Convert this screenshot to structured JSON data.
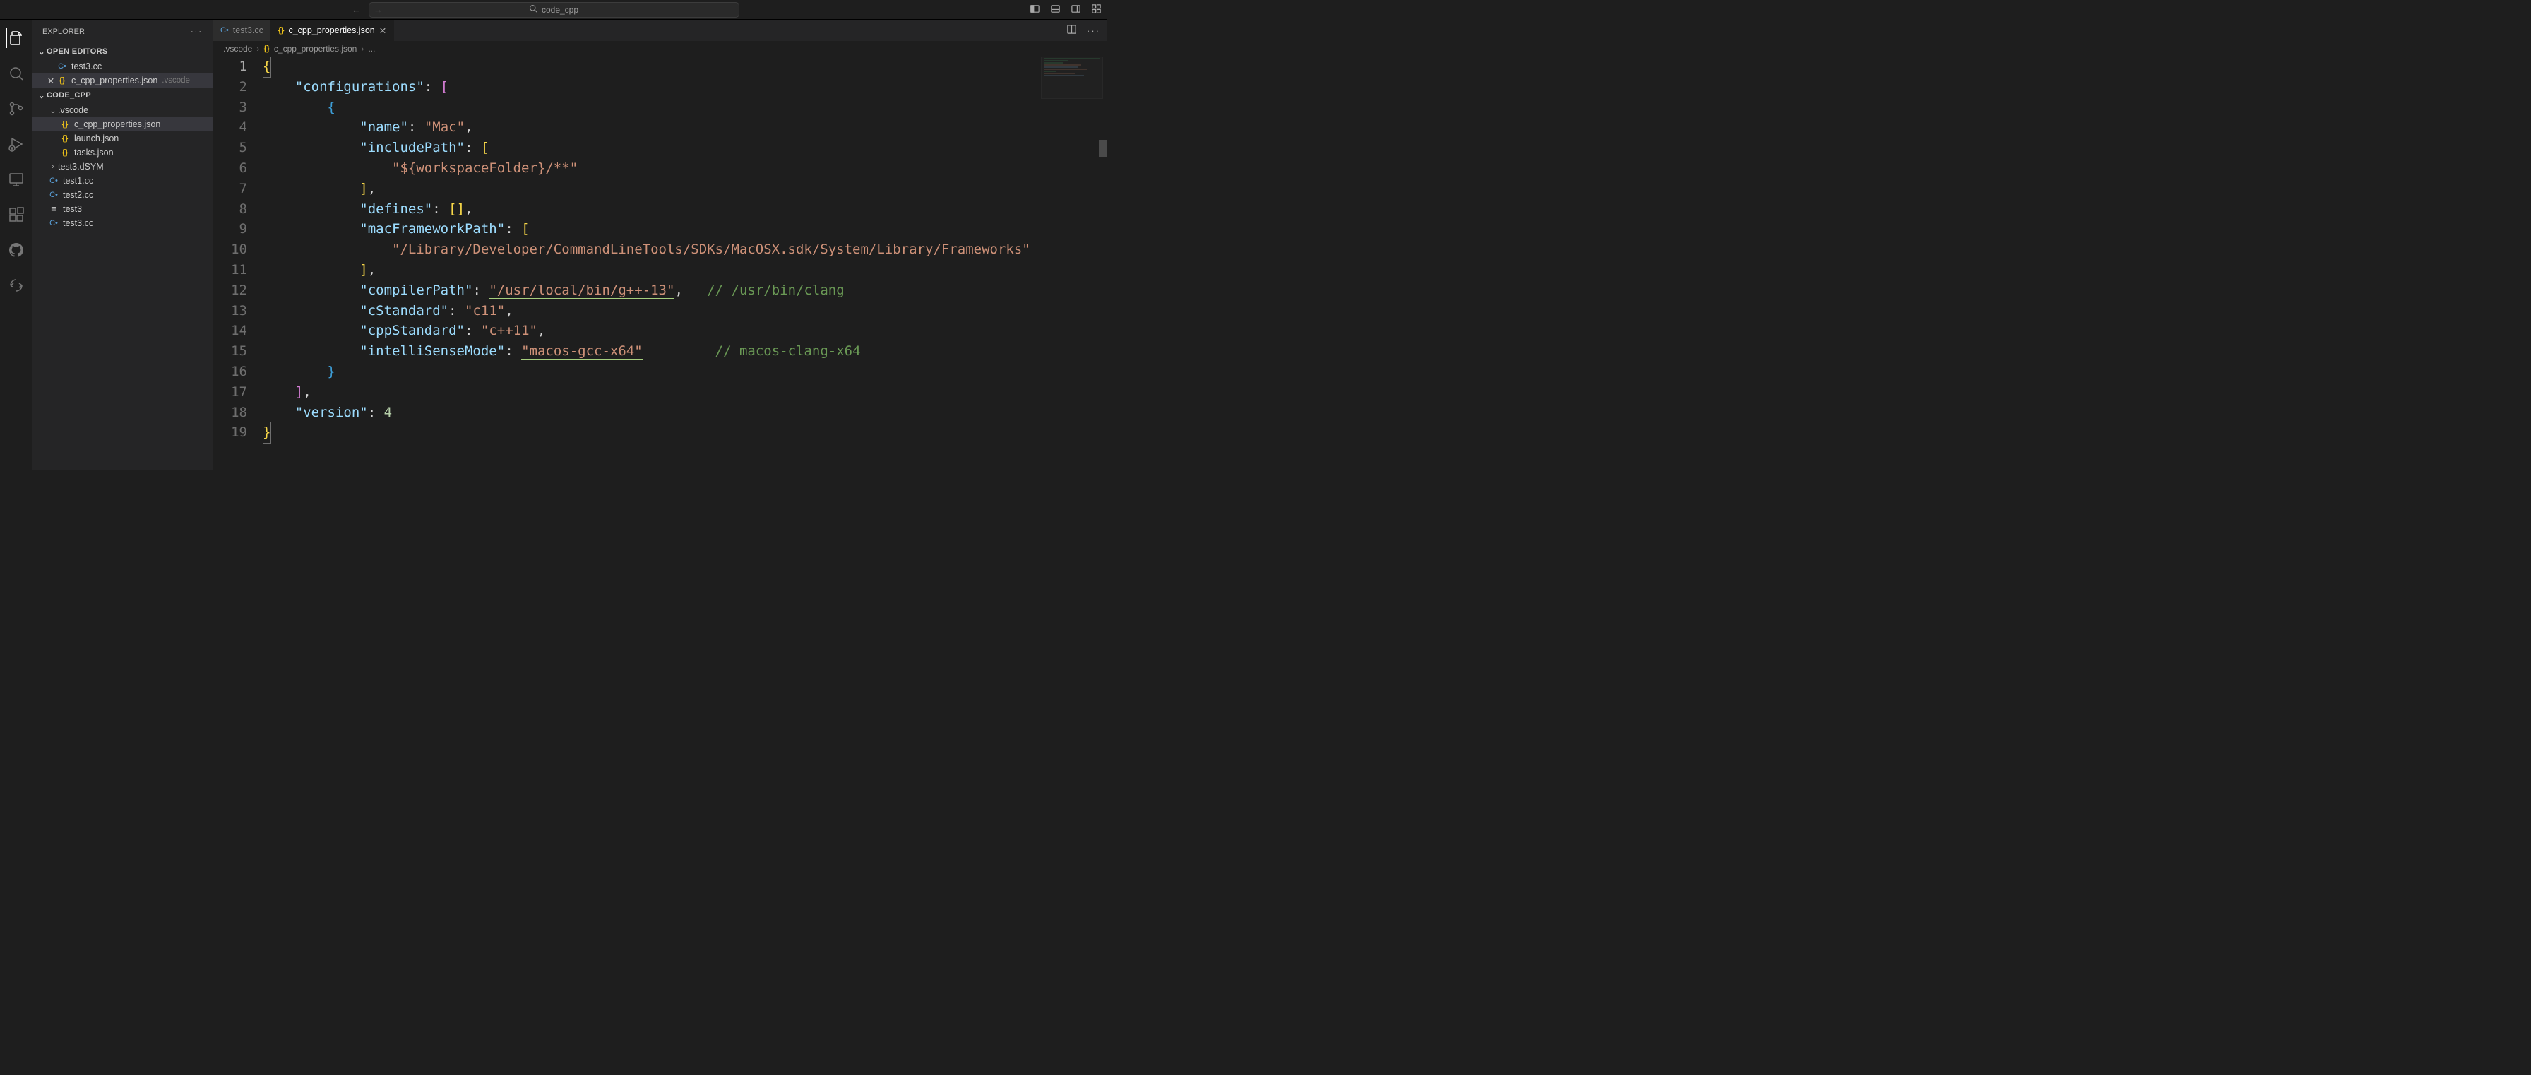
{
  "titlebar": {
    "search_text": "code_cpp"
  },
  "sidebar": {
    "title": "EXPLORER",
    "open_editors_label": "OPEN EDITORS",
    "open_editors": [
      {
        "name": "test3.cc",
        "icon": "cpp"
      },
      {
        "name": "c_cpp_properties.json",
        "icon": "json",
        "dim": ".vscode",
        "close": true,
        "selected": true
      }
    ],
    "workspace_label": "CODE_CPP",
    "tree": [
      {
        "name": ".vscode",
        "kind": "folder",
        "expanded": true,
        "indent": 1
      },
      {
        "name": "c_cpp_properties.json",
        "kind": "file",
        "icon": "json",
        "indent": 2,
        "selected": true,
        "underline": true
      },
      {
        "name": "launch.json",
        "kind": "file",
        "icon": "json",
        "indent": 2
      },
      {
        "name": "tasks.json",
        "kind": "file",
        "icon": "json",
        "indent": 2
      },
      {
        "name": "test3.dSYM",
        "kind": "folder",
        "expanded": false,
        "indent": 1
      },
      {
        "name": "test1.cc",
        "kind": "file",
        "icon": "cpp",
        "indent": 1
      },
      {
        "name": "test2.cc",
        "kind": "file",
        "icon": "cpp",
        "indent": 1
      },
      {
        "name": "test3",
        "kind": "file",
        "icon": "txt",
        "indent": 1
      },
      {
        "name": "test3.cc",
        "kind": "file",
        "icon": "cpp",
        "indent": 1
      }
    ]
  },
  "tabs": [
    {
      "label": "test3.cc",
      "icon": "cpp",
      "active": false
    },
    {
      "label": "c_cpp_properties.json",
      "icon": "json",
      "active": true
    }
  ],
  "breadcrumbs": [
    ".vscode",
    "c_cpp_properties.json",
    "..."
  ],
  "editor": {
    "line_count": 19,
    "lines": [
      [
        {
          "t": "brace-y",
          "v": "{"
        }
      ],
      [
        {
          "t": "indent",
          "v": "    "
        },
        {
          "t": "key",
          "v": "\"configurations\""
        },
        {
          "t": "p",
          "v": ": "
        },
        {
          "t": "brace-p",
          "v": "["
        }
      ],
      [
        {
          "t": "indent",
          "v": "        "
        },
        {
          "t": "brace-b",
          "v": "{"
        }
      ],
      [
        {
          "t": "indent",
          "v": "            "
        },
        {
          "t": "key",
          "v": "\"name\""
        },
        {
          "t": "p",
          "v": ": "
        },
        {
          "t": "str",
          "v": "\"Mac\""
        },
        {
          "t": "p",
          "v": ","
        }
      ],
      [
        {
          "t": "indent",
          "v": "            "
        },
        {
          "t": "key",
          "v": "\"includePath\""
        },
        {
          "t": "p",
          "v": ": "
        },
        {
          "t": "brace-y",
          "v": "["
        }
      ],
      [
        {
          "t": "indent",
          "v": "                "
        },
        {
          "t": "str",
          "v": "\"${workspaceFolder}/**\""
        }
      ],
      [
        {
          "t": "indent",
          "v": "            "
        },
        {
          "t": "brace-y",
          "v": "]"
        },
        {
          "t": "p",
          "v": ","
        }
      ],
      [
        {
          "t": "indent",
          "v": "            "
        },
        {
          "t": "key",
          "v": "\"defines\""
        },
        {
          "t": "p",
          "v": ": "
        },
        {
          "t": "brace-y",
          "v": "[]"
        },
        {
          "t": "p",
          "v": ","
        }
      ],
      [
        {
          "t": "indent",
          "v": "            "
        },
        {
          "t": "key",
          "v": "\"macFrameworkPath\""
        },
        {
          "t": "p",
          "v": ": "
        },
        {
          "t": "brace-y",
          "v": "["
        }
      ],
      [
        {
          "t": "indent",
          "v": "                "
        },
        {
          "t": "str",
          "v": "\"/Library/Developer/CommandLineTools/SDKs/MacOSX.sdk/System/Library/Frameworks\""
        }
      ],
      [
        {
          "t": "indent",
          "v": "            "
        },
        {
          "t": "brace-y",
          "v": "]"
        },
        {
          "t": "p",
          "v": ","
        }
      ],
      [
        {
          "t": "indent",
          "v": "            "
        },
        {
          "t": "key",
          "v": "\"compilerPath\""
        },
        {
          "t": "p",
          "v": ": "
        },
        {
          "t": "str-ul",
          "v": "\"/usr/local/bin/g++-13\""
        },
        {
          "t": "p",
          "v": ",   "
        },
        {
          "t": "comm",
          "v": "// /usr/bin/clang"
        }
      ],
      [
        {
          "t": "indent",
          "v": "            "
        },
        {
          "t": "key",
          "v": "\"cStandard\""
        },
        {
          "t": "p",
          "v": ": "
        },
        {
          "t": "str",
          "v": "\"c11\""
        },
        {
          "t": "p",
          "v": ","
        }
      ],
      [
        {
          "t": "indent",
          "v": "            "
        },
        {
          "t": "key",
          "v": "\"cppStandard\""
        },
        {
          "t": "p",
          "v": ": "
        },
        {
          "t": "str",
          "v": "\"c++11\""
        },
        {
          "t": "p",
          "v": ","
        }
      ],
      [
        {
          "t": "indent",
          "v": "            "
        },
        {
          "t": "key",
          "v": "\"intelliSenseMode\""
        },
        {
          "t": "p",
          "v": ": "
        },
        {
          "t": "str-ul",
          "v": "\"macos-gcc-x64\""
        },
        {
          "t": "p",
          "v": "         "
        },
        {
          "t": "comm",
          "v": "// macos-clang-x64"
        }
      ],
      [
        {
          "t": "indent",
          "v": "        "
        },
        {
          "t": "brace-b",
          "v": "}"
        }
      ],
      [
        {
          "t": "indent",
          "v": "    "
        },
        {
          "t": "brace-p",
          "v": "]"
        },
        {
          "t": "p",
          "v": ","
        }
      ],
      [
        {
          "t": "indent",
          "v": "    "
        },
        {
          "t": "key",
          "v": "\"version\""
        },
        {
          "t": "p",
          "v": ": "
        },
        {
          "t": "num",
          "v": "4"
        }
      ],
      [
        {
          "t": "brace-y",
          "v": "}"
        }
      ]
    ]
  }
}
